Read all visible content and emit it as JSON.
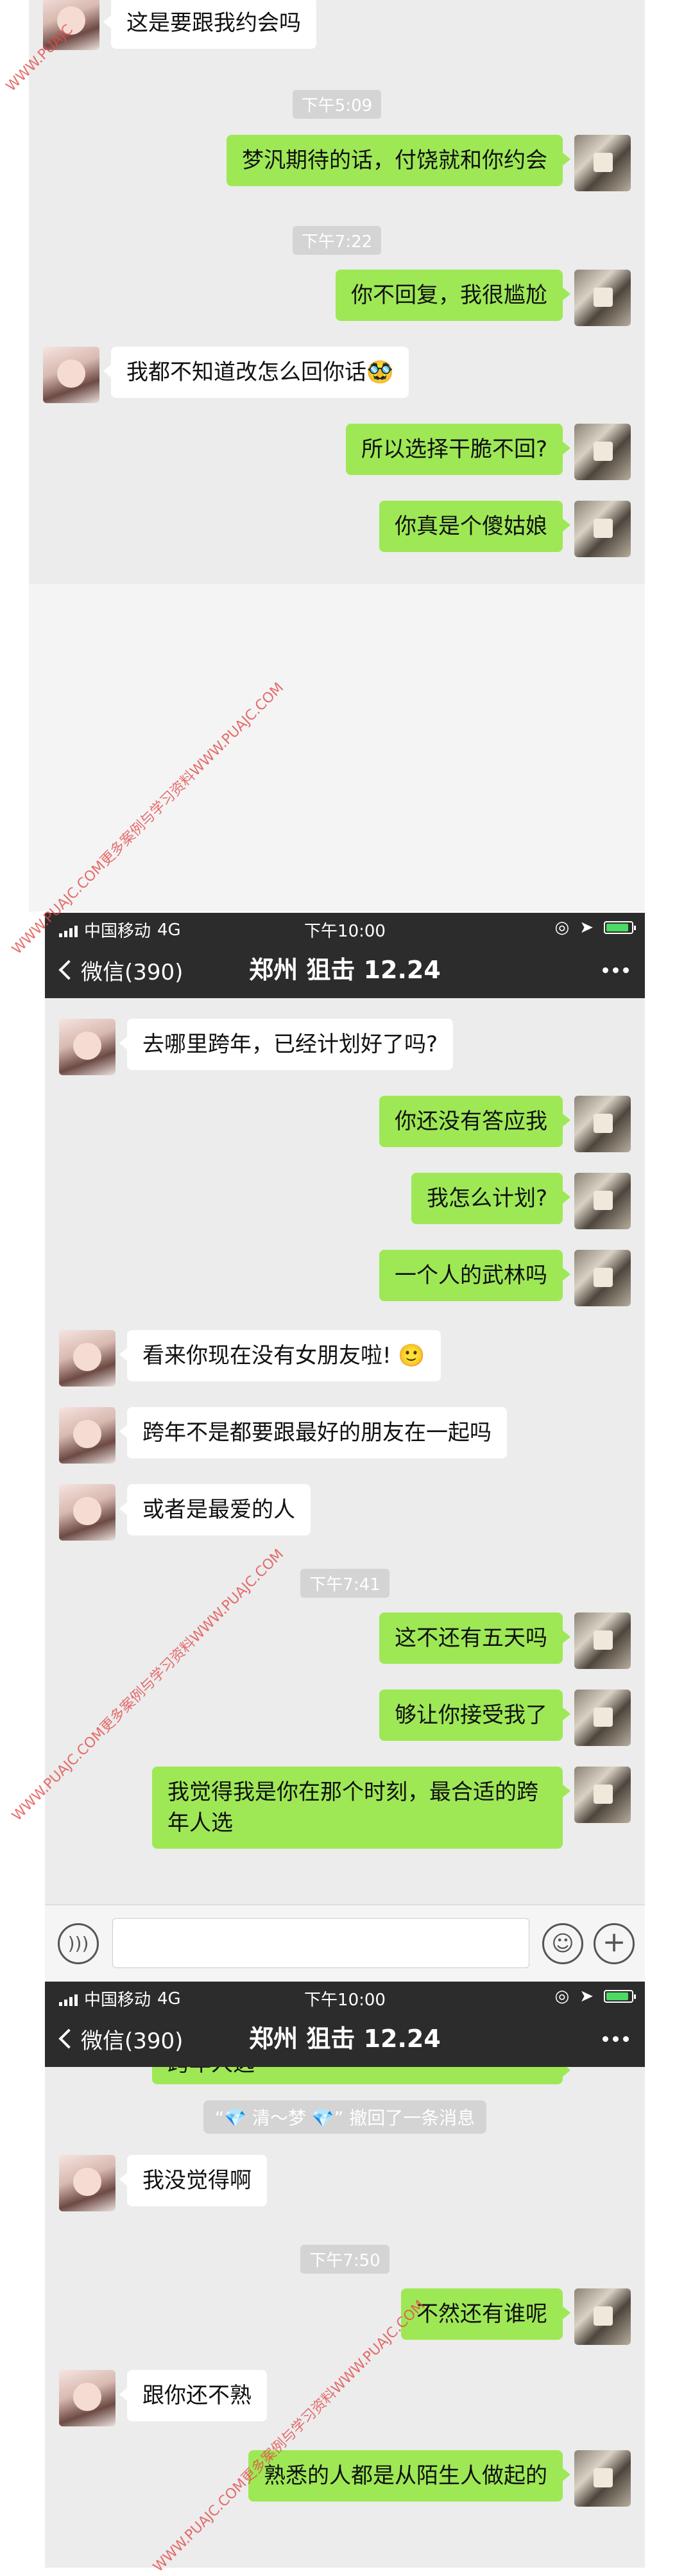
{
  "panel1": {
    "messages": [
      {
        "side": "in",
        "text": "这是要跟我约会吗"
      },
      {
        "type": "time",
        "text": "下午5:09"
      },
      {
        "side": "out",
        "text": "梦汎期待的话，付饶就和你约会"
      },
      {
        "type": "time",
        "text": "下午7:22"
      },
      {
        "side": "out",
        "text": "你不回复，我很尴尬"
      },
      {
        "side": "in",
        "text": "我都不知道改怎么回你话🥸"
      },
      {
        "side": "out",
        "text": "所以选择干脆不回?"
      },
      {
        "side": "out",
        "text": "你真是个傻姑娘"
      }
    ]
  },
  "status": {
    "carrier": "中国移动",
    "network": "4G",
    "time": "下午10:00"
  },
  "nav": {
    "back_label": "微信(390)",
    "title": "郑州 狙击 12.24"
  },
  "panel2": {
    "messages": [
      {
        "side": "in",
        "text": "去哪里跨年，已经计划好了吗?"
      },
      {
        "side": "out",
        "text": "你还没有答应我"
      },
      {
        "side": "out",
        "text": "我怎么计划?"
      },
      {
        "side": "out",
        "text": "一个人的武林吗"
      },
      {
        "side": "in",
        "text": "看来你现在没有女朋友啦! 🙂"
      },
      {
        "side": "in",
        "text": "跨年不是都要跟最好的朋友在一起吗"
      },
      {
        "side": "in",
        "text": "或者是最爱的人"
      },
      {
        "type": "time",
        "text": "下午7:41"
      },
      {
        "side": "out",
        "text": "这不还有五天吗"
      },
      {
        "side": "out",
        "text": "够让你接受我了"
      },
      {
        "side": "out",
        "text": "我觉得我是你在那个时刻，最合适的跨年人选"
      }
    ]
  },
  "panel3": {
    "partial_text": "跨年人选",
    "recall_notice": "“💎 清～梦 💎” 撤回了一条消息",
    "messages": [
      {
        "side": "in",
        "text": "我没觉得啊"
      },
      {
        "type": "time",
        "text": "下午7:50"
      },
      {
        "side": "out",
        "text": "不然还有谁呢"
      },
      {
        "side": "in",
        "text": "跟你还不熟"
      },
      {
        "side": "out",
        "text": "熟悉的人都是从陌生人做起的"
      }
    ]
  },
  "watermark": "WWW.PUAJC.COM更多案例与学习资料WWW.PUAJC.COM",
  "watermark_short": "WWW.PUAJC"
}
